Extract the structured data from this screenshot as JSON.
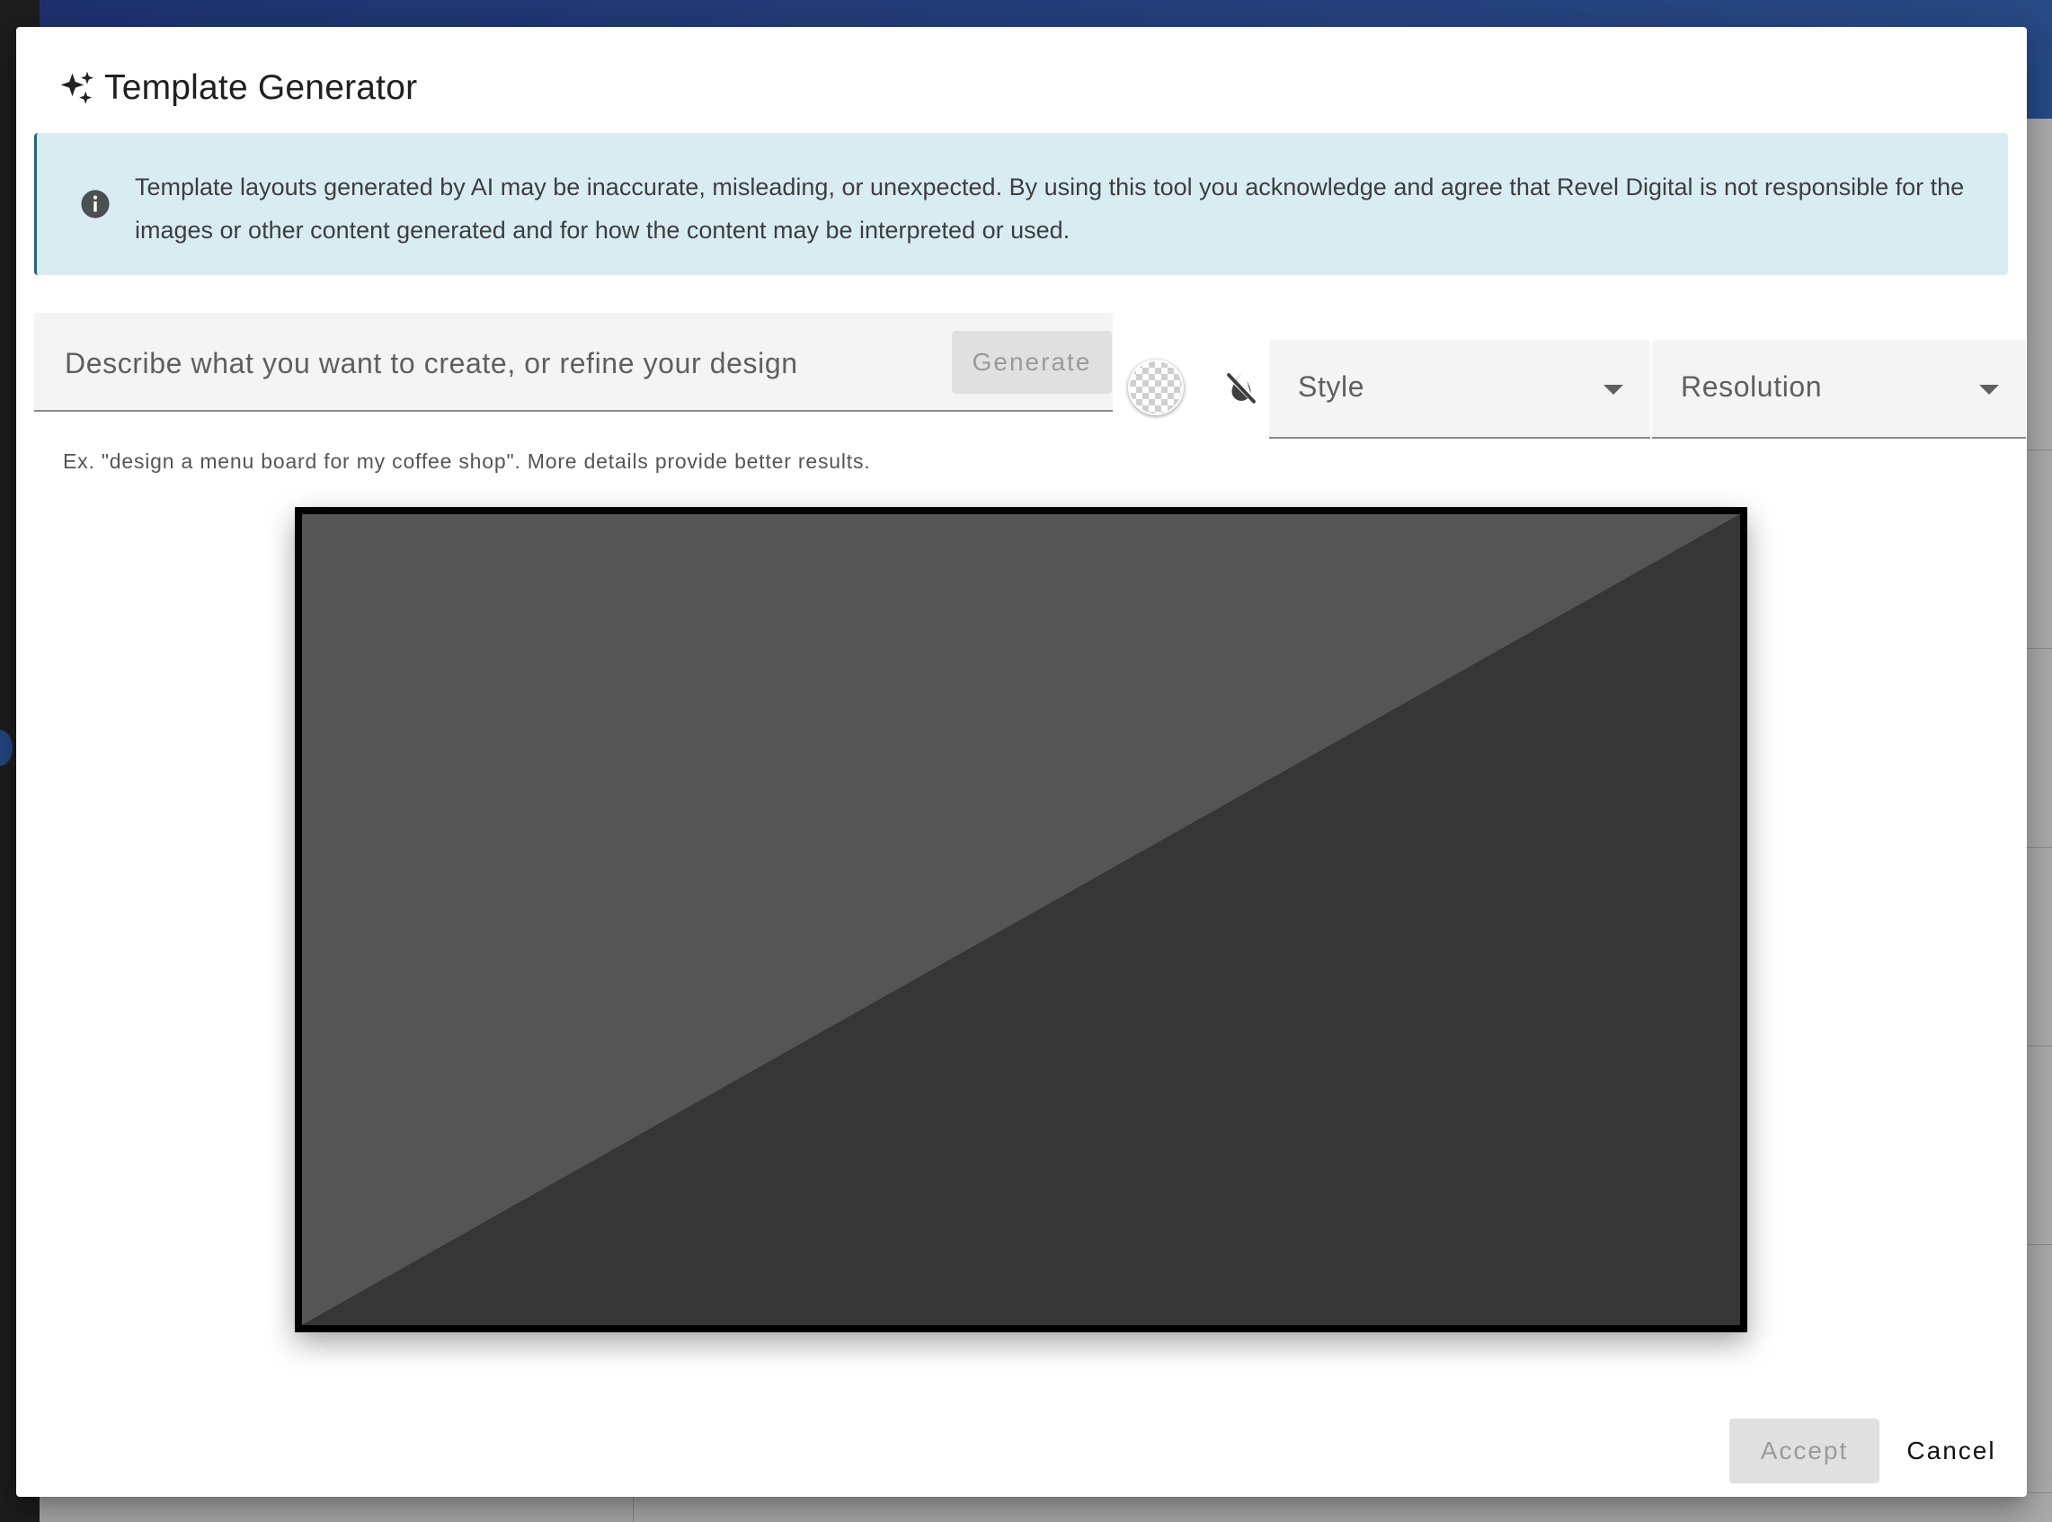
{
  "dialog": {
    "title": "Template Generator",
    "title_icon": "sparkles-icon"
  },
  "alert": {
    "icon": "info-icon",
    "text": "Template layouts generated by AI may be inaccurate, misleading, or unexpected. By using this tool you acknowledge and agree that Revel Digital is not responsible for the images or other content generated and for how the content may be interpreted or used."
  },
  "prompt": {
    "placeholder": "Describe what you want to create, or refine your design",
    "value": "",
    "helper": "Ex. \"design a menu board for my coffee shop\". More details provide better results.",
    "generate_label": "Generate"
  },
  "color_controls": {
    "background_swatch": "transparent",
    "no_color_icon": "format-color-reset-icon"
  },
  "selects": {
    "style_label": "Style",
    "resolution_label": "Resolution"
  },
  "preview": {
    "colors": {
      "frame": "#000000",
      "upper": "#555555",
      "lower": "#363636"
    }
  },
  "actions": {
    "accept_label": "Accept",
    "cancel_label": "Cancel"
  },
  "colors": {
    "alert_bg": "#d9ecf2",
    "field_bg": "#f4f4f4",
    "disabled_btn_bg": "#e0e0e0",
    "header_blue": "#3d6cc4"
  }
}
